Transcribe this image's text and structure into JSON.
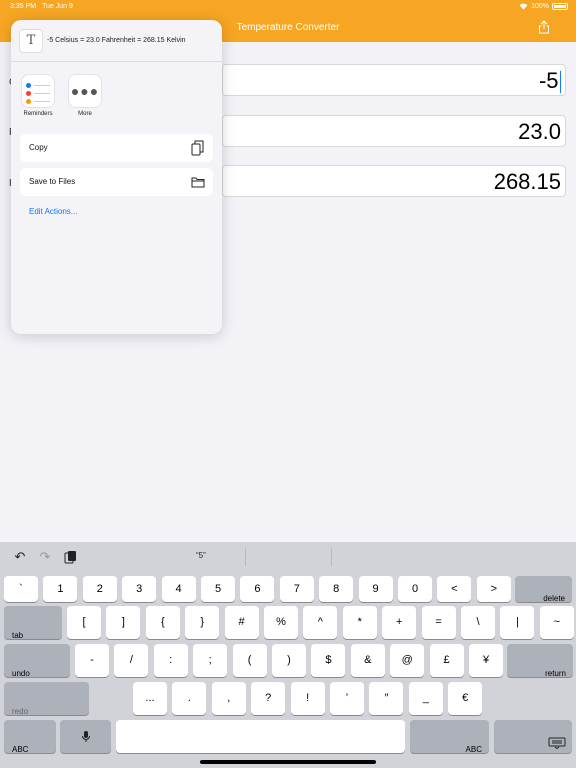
{
  "status_bar": {
    "time": "3:35 PM",
    "date": "Tue Jun 9",
    "battery": "100%"
  },
  "navbar": {
    "title": "Temperature Converter",
    "share_icon": "share-icon"
  },
  "side_labels": [
    "C",
    "F",
    "K"
  ],
  "fields": {
    "celsius": "-5",
    "fahrenheit": "23.0",
    "kelvin": "268.15"
  },
  "share_sheet": {
    "preview_text": "-5 Celsius = 23.0 Fahrenheit = 268.15 Kelvin",
    "apps": [
      {
        "label": "Reminders",
        "icon": "reminders-icon"
      },
      {
        "label": "More",
        "icon": "more-icon"
      }
    ],
    "actions": [
      {
        "label": "Copy",
        "icon": "copy-icon"
      },
      {
        "label": "Save to Files",
        "icon": "folder-icon"
      }
    ],
    "edit_actions": "Edit Actions..."
  },
  "keyboard": {
    "suggestion": "“5”",
    "row1": [
      "`",
      "1",
      "2",
      "3",
      "4",
      "5",
      "6",
      "7",
      "8",
      "9",
      "0",
      "<",
      ">"
    ],
    "delete": "delete",
    "tab": "tab",
    "row2": [
      "[",
      "]",
      "{",
      "}",
      "#",
      "%",
      "^",
      "*",
      "+",
      "=",
      "\\",
      "|",
      "~"
    ],
    "undo": "undo",
    "row3": [
      "-",
      "/",
      ":",
      ";",
      "(",
      ")",
      "$",
      "&",
      "@",
      "£",
      "¥"
    ],
    "return": "return",
    "redo": "redo",
    "row4": [
      "...",
      ".",
      ",",
      "?",
      "!",
      "’",
      "″",
      "_",
      "€"
    ],
    "abc_left": "ABC",
    "abc_right": "ABC"
  },
  "colors": {
    "accent": "#f6a623",
    "link": "#0a7aff"
  }
}
